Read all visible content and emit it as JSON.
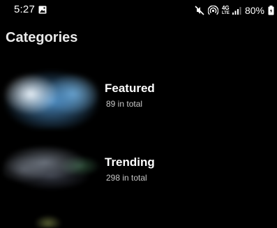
{
  "status_bar": {
    "time": "5:27",
    "battery": "80%",
    "network_top": "4G",
    "network_bottom": "LTE",
    "icons": [
      "gallery-icon",
      "mute-icon",
      "hotspot-icon",
      "signal-icon",
      "battery-icon"
    ]
  },
  "page": {
    "title": "Categories"
  },
  "categories": [
    {
      "title": "Featured",
      "count": "89 in total"
    },
    {
      "title": "Trending",
      "count": "298 in total"
    }
  ],
  "colors": {
    "background": "#000000",
    "text_primary": "#ffffff",
    "text_secondary": "#c8c8c8"
  }
}
